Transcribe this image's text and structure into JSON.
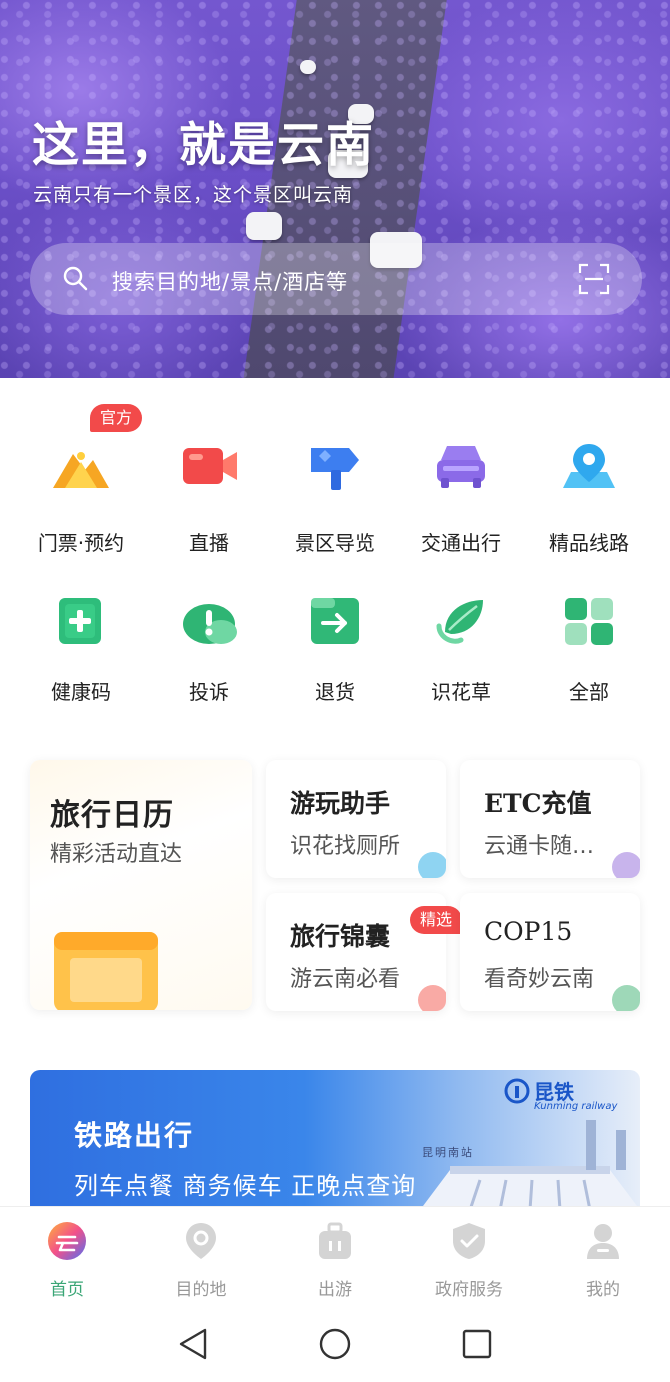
{
  "hero": {
    "title": "这里，就是云南",
    "subtitle": "云南只有一个景区，这个景区叫云南"
  },
  "search": {
    "placeholder": "搜索目的地/景点/酒店等",
    "search_icon": "search-icon",
    "scan_icon": "scan-icon"
  },
  "grid": {
    "official_badge": "官方",
    "items": [
      {
        "label": "门票·预约",
        "icon": "mountain-ticket-icon"
      },
      {
        "label": "直播",
        "icon": "video-camera-icon"
      },
      {
        "label": "景区导览",
        "icon": "signpost-icon"
      },
      {
        "label": "交通出行",
        "icon": "car-icon"
      },
      {
        "label": "精品线路",
        "icon": "map-pin-icon"
      },
      {
        "label": "健康码",
        "icon": "health-plus-icon"
      },
      {
        "label": "投诉",
        "icon": "alert-cloud-icon"
      },
      {
        "label": "退货",
        "icon": "return-arrow-icon"
      },
      {
        "label": "识花草",
        "icon": "leaf-icon"
      },
      {
        "label": "全部",
        "icon": "all-grid-icon"
      }
    ]
  },
  "cards": {
    "calendar": {
      "title": "旅行日历",
      "subtitle": "精彩活动直达"
    },
    "assistant": {
      "title": "游玩助手",
      "subtitle": "识花找厕所"
    },
    "etc": {
      "title": "ETC充值",
      "subtitle": "云通卡随…"
    },
    "guide": {
      "title": "旅行锦囊",
      "subtitle": "游云南必看",
      "badge": "精选"
    },
    "cop15": {
      "title": "COP15",
      "subtitle": "看奇妙云南"
    }
  },
  "banner": {
    "title": "铁路出行",
    "subtitle": "列车点餐 商务候车 正晚点查询",
    "logo_text": "昆铁",
    "logo_sub": "Kunming railway",
    "station": "昆明南站"
  },
  "tabs": [
    {
      "label": "首页",
      "icon": "home-cloud-icon",
      "active": true
    },
    {
      "label": "目的地",
      "icon": "location-icon",
      "active": false
    },
    {
      "label": "出游",
      "icon": "luggage-icon",
      "active": false
    },
    {
      "label": "政府服务",
      "icon": "shield-check-icon",
      "active": false
    },
    {
      "label": "我的",
      "icon": "user-icon",
      "active": false
    }
  ],
  "colors": {
    "accent_green": "#3aa676",
    "badge_red": "#f24a4a",
    "hero_purple": "#6b4fc8"
  }
}
